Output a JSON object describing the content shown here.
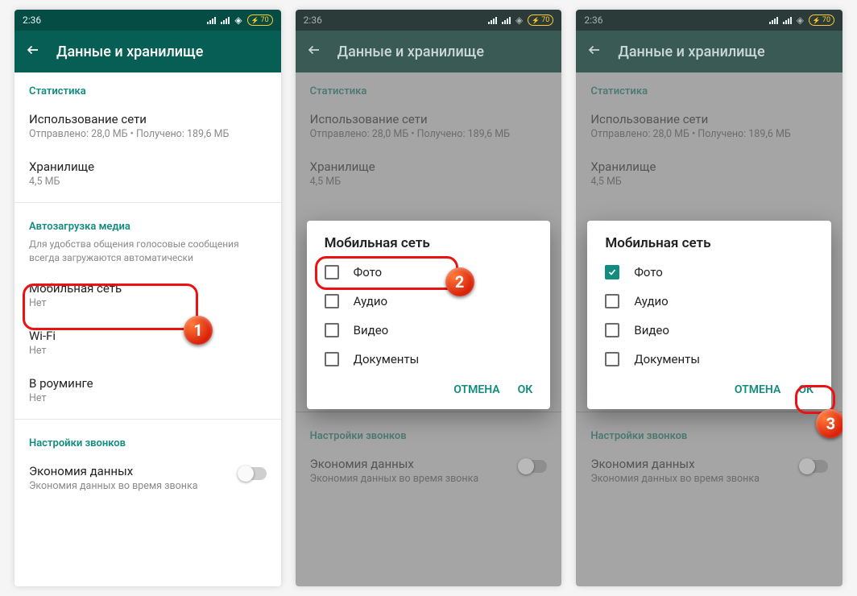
{
  "status": {
    "time": "2:36",
    "battery": "70"
  },
  "appbar": {
    "title": "Данные и хранилище"
  },
  "sections": {
    "stats": {
      "header": "Статистика",
      "network_title": "Использование сети",
      "network_sub": "Отправлено: 28,0 МБ • Получено: 189,6 МБ",
      "storage_title": "Хранилище",
      "storage_sub": "4,5 МБ"
    },
    "autodl": {
      "header": "Автозагрузка медиа",
      "note": "Для удобства общения голосовые сообщения всегда загружаются автоматически",
      "mobile_title": "Мобильная сеть",
      "mobile_sub": "Нет",
      "wifi_title": "Wi-Fi",
      "wifi_sub": "Нет",
      "roaming_title": "В роуминге",
      "roaming_sub": "Нет"
    },
    "calls": {
      "header": "Настройки звонков",
      "lowdata_title": "Экономия данных",
      "lowdata_sub": "Экономия данных во время звонка"
    }
  },
  "dialog": {
    "title": "Мобильная сеть",
    "options": {
      "photo": "Фото",
      "audio": "Аудио",
      "video": "Видео",
      "docs": "Документы"
    },
    "cancel": "ОТМЕНА",
    "ok": "ОК"
  },
  "badges": {
    "one": "1",
    "two": "2",
    "three": "3"
  }
}
